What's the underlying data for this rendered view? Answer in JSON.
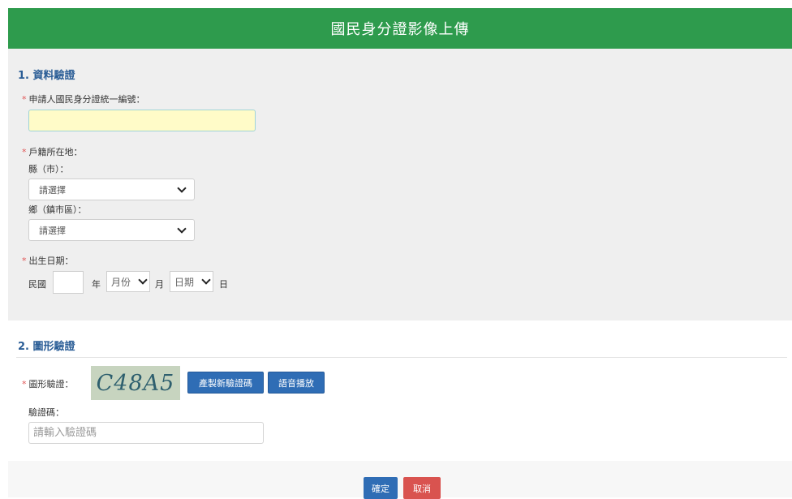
{
  "header": {
    "title": "國民身分證影像上傳"
  },
  "section1": {
    "title": "1. 資料驗證",
    "id_label": "申請人國民身分證統一編號：",
    "household_label": "戶籍所在地：",
    "county_label": "縣（市）：",
    "county_select": "請選擇",
    "township_label": "鄉（鎮市區）：",
    "township_select": "請選擇",
    "birth_label": "出生日期：",
    "roc_label": "民國",
    "year_label": "年",
    "month_select": "月份",
    "month_label": "月",
    "day_select": "日期",
    "day_label": "日"
  },
  "section2": {
    "title": "2. 圖形驗證",
    "captcha_label": "圖形驗證：",
    "captcha_text": "C48A5",
    "refresh_button": "產製新驗證碼",
    "audio_button": "語音播放",
    "code_label": "驗證碼：",
    "code_placeholder": "請輸入驗證碼"
  },
  "actions": {
    "confirm": "確定",
    "cancel": "取消"
  },
  "colors": {
    "header": "#2e9b4d",
    "primary": "#2f6db5",
    "danger": "#d9534f"
  }
}
